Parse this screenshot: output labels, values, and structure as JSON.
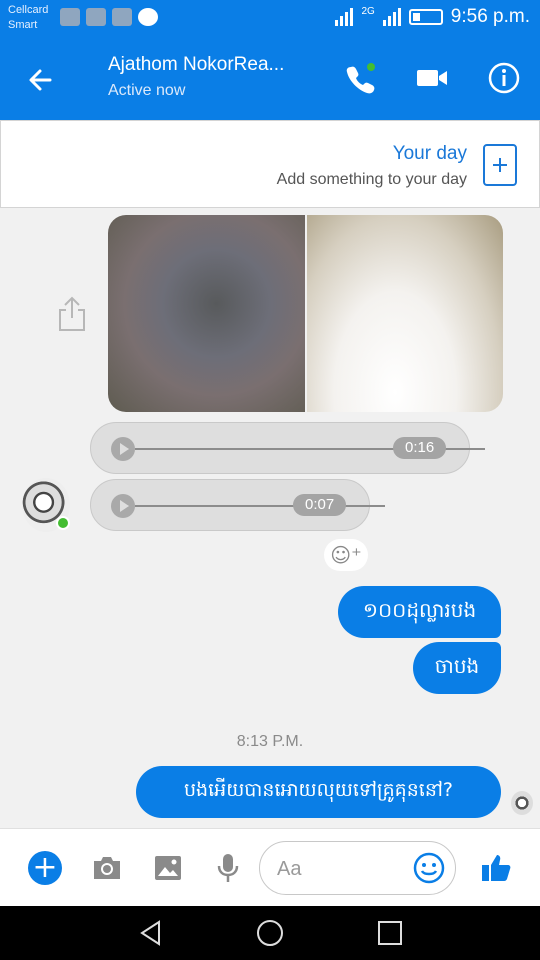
{
  "status_bar": {
    "carrier_line1": "Cellcard",
    "carrier_line2": "Smart",
    "network": "2G",
    "time": "9:56 p.m."
  },
  "header": {
    "title": "Ajathom NokorRea...",
    "status": "Active now",
    "accent_color": "#0a7ee6"
  },
  "your_day": {
    "title": "Your day",
    "subtitle": "Add something to your day"
  },
  "messages": {
    "audio": [
      {
        "duration": "0:16"
      },
      {
        "duration": "0:07"
      }
    ],
    "outgoing": [
      {
        "text": "១០០ដុល្លារបង"
      },
      {
        "text": "ចាបង"
      }
    ],
    "timestamp": "8:13 P.M.",
    "last_outgoing": {
      "text": "បងអើយបានអោយលុយទៅគ្រូគុននៅ?"
    }
  },
  "composer": {
    "placeholder": "Aa"
  },
  "icons": {
    "header": [
      "back-arrow-icon",
      "phone-icon",
      "video-camera-icon",
      "info-icon"
    ],
    "composer": [
      "plus-icon",
      "camera-icon",
      "gallery-icon",
      "microphone-icon",
      "emoji-icon",
      "thumbs-up-icon"
    ],
    "nav": [
      "back-triangle-icon",
      "home-circle-icon",
      "recents-square-icon"
    ]
  }
}
